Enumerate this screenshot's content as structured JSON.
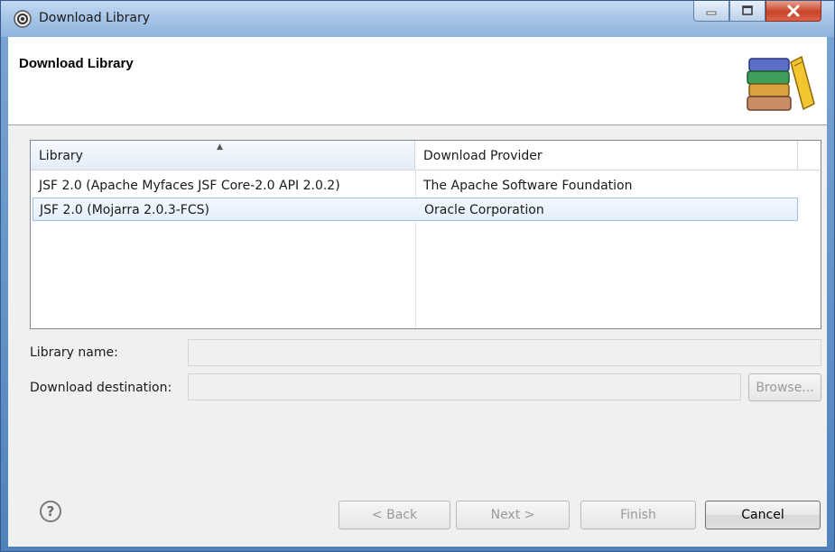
{
  "window": {
    "title": "Download Library",
    "controls": [
      "minimize-icon",
      "maximize-icon",
      "close-icon"
    ]
  },
  "header": {
    "title": "Download Library",
    "icon": "library-books-icon"
  },
  "table": {
    "columns": [
      "Library",
      "Download Provider"
    ],
    "sorted_column": "Library",
    "rows": [
      {
        "library": "JSF 2.0 (Apache Myfaces JSF Core-2.0 API 2.0.2)",
        "provider": "The Apache Software Foundation",
        "selected": false
      },
      {
        "library": "JSF 2.0 (Mojarra 2.0.3-FCS)",
        "provider": "Oracle Corporation",
        "selected": true
      }
    ]
  },
  "form": {
    "library_name_label": "Library name:",
    "library_name_value": "",
    "destination_label": "Download destination:",
    "destination_value": "",
    "browse_label": "Browse..."
  },
  "footer": {
    "help_icon": "help-icon",
    "back_label": "< Back",
    "next_label": "Next >",
    "finish_label": "Finish",
    "cancel_label": "Cancel"
  },
  "colors": {
    "selection_border": "#9dc1ea",
    "selection_fill": "#e4eefb",
    "title_bar": "#a8c6e8",
    "close_button": "#c7442a"
  }
}
